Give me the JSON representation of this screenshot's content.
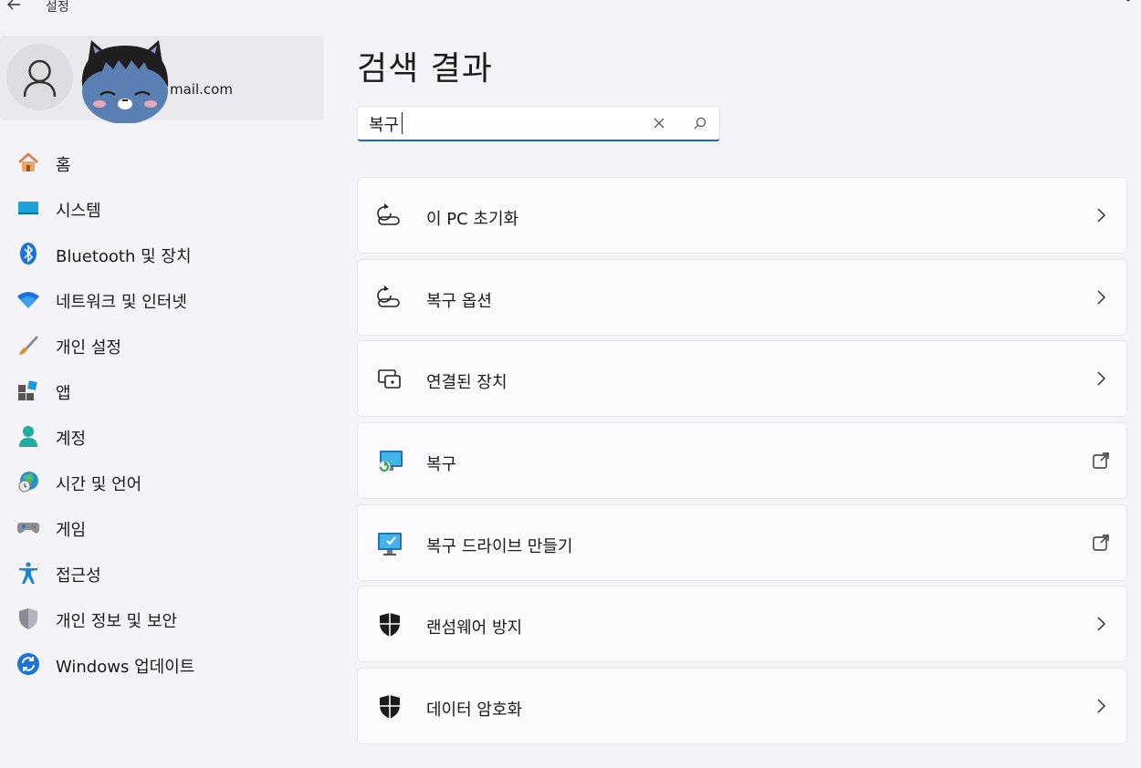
{
  "window": {
    "title": "설정",
    "back_icon": "←",
    "minimize_icon": "▫",
    "close_icon": "✕"
  },
  "account": {
    "email": "mail.com"
  },
  "nav": {
    "items": [
      {
        "label": "홈",
        "icon": "home-icon"
      },
      {
        "label": "시스템",
        "icon": "system-icon"
      },
      {
        "label": "Bluetooth 및 장치",
        "icon": "bluetooth-icon"
      },
      {
        "label": "네트워크 및 인터넷",
        "icon": "wifi-icon"
      },
      {
        "label": "개인 설정",
        "icon": "brush-icon"
      },
      {
        "label": "앱",
        "icon": "apps-icon"
      },
      {
        "label": "계정",
        "icon": "account-icon"
      },
      {
        "label": "시간 및 언어",
        "icon": "globe-clock-icon"
      },
      {
        "label": "게임",
        "icon": "gamepad-icon"
      },
      {
        "label": "접근성",
        "icon": "accessibility-icon"
      },
      {
        "label": "개인 정보 및 보안",
        "icon": "shield-icon"
      },
      {
        "label": "Windows 업데이트",
        "icon": "update-icon"
      }
    ]
  },
  "main": {
    "title": "검색 결과",
    "search": {
      "value": "복구"
    },
    "results": [
      {
        "label": "이 PC 초기화",
        "icon": "reset-pc-icon",
        "action": "chevron-right-icon"
      },
      {
        "label": "복구 옵션",
        "icon": "recovery-options-icon",
        "action": "chevron-right-icon"
      },
      {
        "label": "연결된 장치",
        "icon": "connected-devices-icon",
        "action": "chevron-right-icon"
      },
      {
        "label": "복구",
        "icon": "recovery-monitor-icon",
        "action": "external-link-icon"
      },
      {
        "label": "복구 드라이브 만들기",
        "icon": "recovery-drive-icon",
        "action": "external-link-icon"
      },
      {
        "label": "랜섬웨어 방지",
        "icon": "ransomware-shield-icon",
        "action": "chevron-right-icon"
      },
      {
        "label": "데이터 암호화",
        "icon": "encryption-shield-icon",
        "action": "chevron-right-icon"
      }
    ]
  },
  "colors": {
    "accent": "#1a66c6",
    "background": "#f3f3f8",
    "card": "#fbfbfd"
  }
}
